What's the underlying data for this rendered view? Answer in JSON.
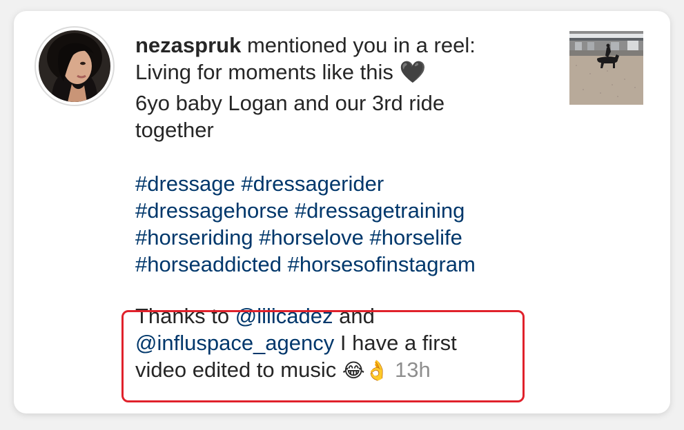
{
  "notification": {
    "username": "nezaspruk",
    "action": " mentioned you in a reel:",
    "caption_line1": "Living for moments like this 🖤",
    "caption_line2": "6yo baby Logan and our 3rd ride",
    "caption_line3": "together",
    "hashtags": [
      "#dressage #dressagerider",
      "#dressagehorse #dressagetraining",
      "#horseriding #horselove #horselife",
      "#horseaddicted #horsesofinstagram"
    ],
    "thanks": {
      "prefix": "Thanks to ",
      "mention1": "@lilicadez",
      "middle": " and",
      "mention2": "@influspace_agency",
      "line2_suffix": " I have a first",
      "line3": "video edited to music ",
      "emojis": "😂👌",
      "time": "13h"
    },
    "avatar_icon": "profile-photo",
    "thumbnail_icon": "reel-thumbnail-horse-arena"
  },
  "colors": {
    "hashtag": "#00376b",
    "highlight": "#e0212b",
    "text": "#262626",
    "timestamp": "#8e8e8e"
  }
}
